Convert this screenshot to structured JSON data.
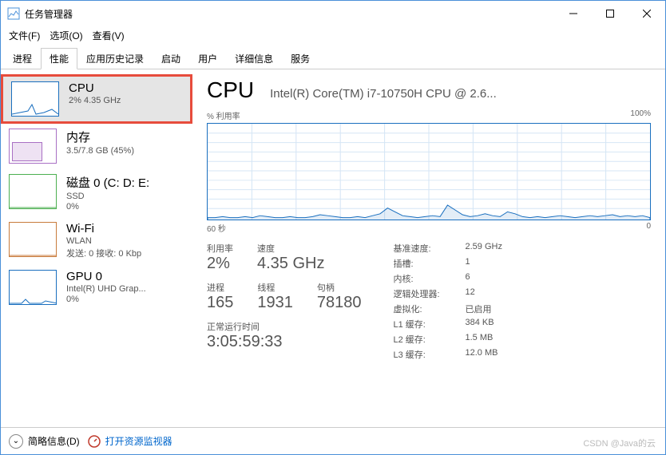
{
  "window": {
    "title": "任务管理器",
    "menu": {
      "file": "文件(F)",
      "options": "选项(O)",
      "view": "查看(V)"
    }
  },
  "tabs": [
    "进程",
    "性能",
    "应用历史记录",
    "启动",
    "用户",
    "详细信息",
    "服务"
  ],
  "sidebar": {
    "items": [
      {
        "title": "CPU",
        "sub": "2% 4.35 GHz"
      },
      {
        "title": "内存",
        "sub": "3.5/7.8 GB (45%)"
      },
      {
        "title": "磁盘 0 (C: D: E:",
        "sub": "SSD",
        "sub2": "0%"
      },
      {
        "title": "Wi-Fi",
        "sub": "WLAN",
        "sub2": "发送: 0 接收: 0 Kbp"
      },
      {
        "title": "GPU 0",
        "sub": "Intel(R) UHD Grap...",
        "sub2": "0%"
      }
    ]
  },
  "main": {
    "title": "CPU",
    "subtitle": "Intel(R) Core(TM) i7-10750H CPU @ 2.6...",
    "chart_top_left": "% 利用率",
    "chart_top_right": "100%",
    "chart_bottom_left": "60 秒",
    "chart_bottom_right": "0",
    "stats": {
      "util_label": "利用率",
      "util_value": "2%",
      "speed_label": "速度",
      "speed_value": "4.35 GHz",
      "proc_label": "进程",
      "proc_value": "165",
      "threads_label": "线程",
      "threads_value": "1931",
      "handles_label": "句柄",
      "handles_value": "78180",
      "uptime_label": "正常运行时间",
      "uptime_value": "3:05:59:33"
    },
    "right": [
      {
        "label": "基准速度:",
        "value": "2.59 GHz"
      },
      {
        "label": "插槽:",
        "value": "1"
      },
      {
        "label": "内核:",
        "value": "6"
      },
      {
        "label": "逻辑处理器:",
        "value": "12"
      },
      {
        "label": "虚拟化:",
        "value": "已启用"
      },
      {
        "label": "L1 缓存:",
        "value": "384 KB"
      },
      {
        "label": "L2 缓存:",
        "value": "1.5 MB"
      },
      {
        "label": "L3 缓存:",
        "value": "12.0 MB"
      }
    ]
  },
  "footer": {
    "brief": "简略信息(D)",
    "resmon": "打开资源监视器"
  },
  "watermark": "CSDN @Java的云",
  "chart_data": {
    "type": "line",
    "title": "% 利用率",
    "xlabel": "60 秒",
    "ylabel": "",
    "ylim": [
      0,
      100
    ],
    "xlim_seconds": [
      60,
      0
    ],
    "series": [
      {
        "name": "CPU 利用率",
        "values": [
          2,
          2,
          3,
          2,
          2,
          3,
          2,
          4,
          3,
          2,
          2,
          3,
          2,
          2,
          3,
          5,
          4,
          3,
          2,
          2,
          3,
          2,
          4,
          6,
          12,
          8,
          4,
          3,
          2,
          3,
          4,
          3,
          15,
          10,
          5,
          3,
          4,
          6,
          4,
          3,
          8,
          6,
          3,
          2,
          3,
          2,
          3,
          4,
          3,
          2,
          3,
          4,
          3,
          4,
          5,
          3,
          4,
          3,
          4,
          2
        ]
      }
    ]
  }
}
